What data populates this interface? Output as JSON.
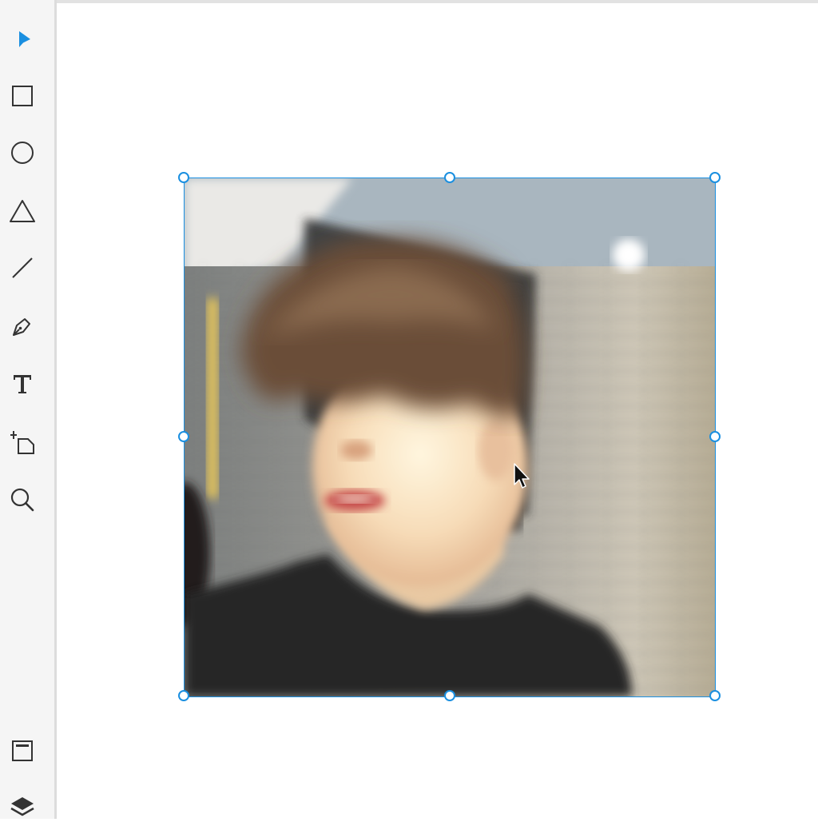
{
  "colors": {
    "accent": "#1a8fe0",
    "toolbar_bg": "#f5f5f5",
    "icon": "#333333"
  },
  "toolbar": {
    "tools": [
      {
        "name": "select-tool",
        "icon": "arrow-pointer-icon",
        "active": true
      },
      {
        "name": "rectangle-tool",
        "icon": "square-icon"
      },
      {
        "name": "ellipse-tool",
        "icon": "circle-icon"
      },
      {
        "name": "triangle-tool",
        "icon": "triangle-icon"
      },
      {
        "name": "line-tool",
        "icon": "line-icon"
      },
      {
        "name": "pen-tool",
        "icon": "pen-nib-icon"
      },
      {
        "name": "text-tool",
        "icon": "text-icon"
      },
      {
        "name": "artboard-tool",
        "icon": "artboard-icon"
      },
      {
        "name": "zoom-tool",
        "icon": "magnifier-icon"
      }
    ],
    "bottom": [
      {
        "name": "assets-panel",
        "icon": "panel-icon"
      },
      {
        "name": "layers-panel",
        "icon": "layers-icon"
      }
    ]
  },
  "canvas": {
    "selected_object": "photo-of-person",
    "selection_handles": 8
  }
}
